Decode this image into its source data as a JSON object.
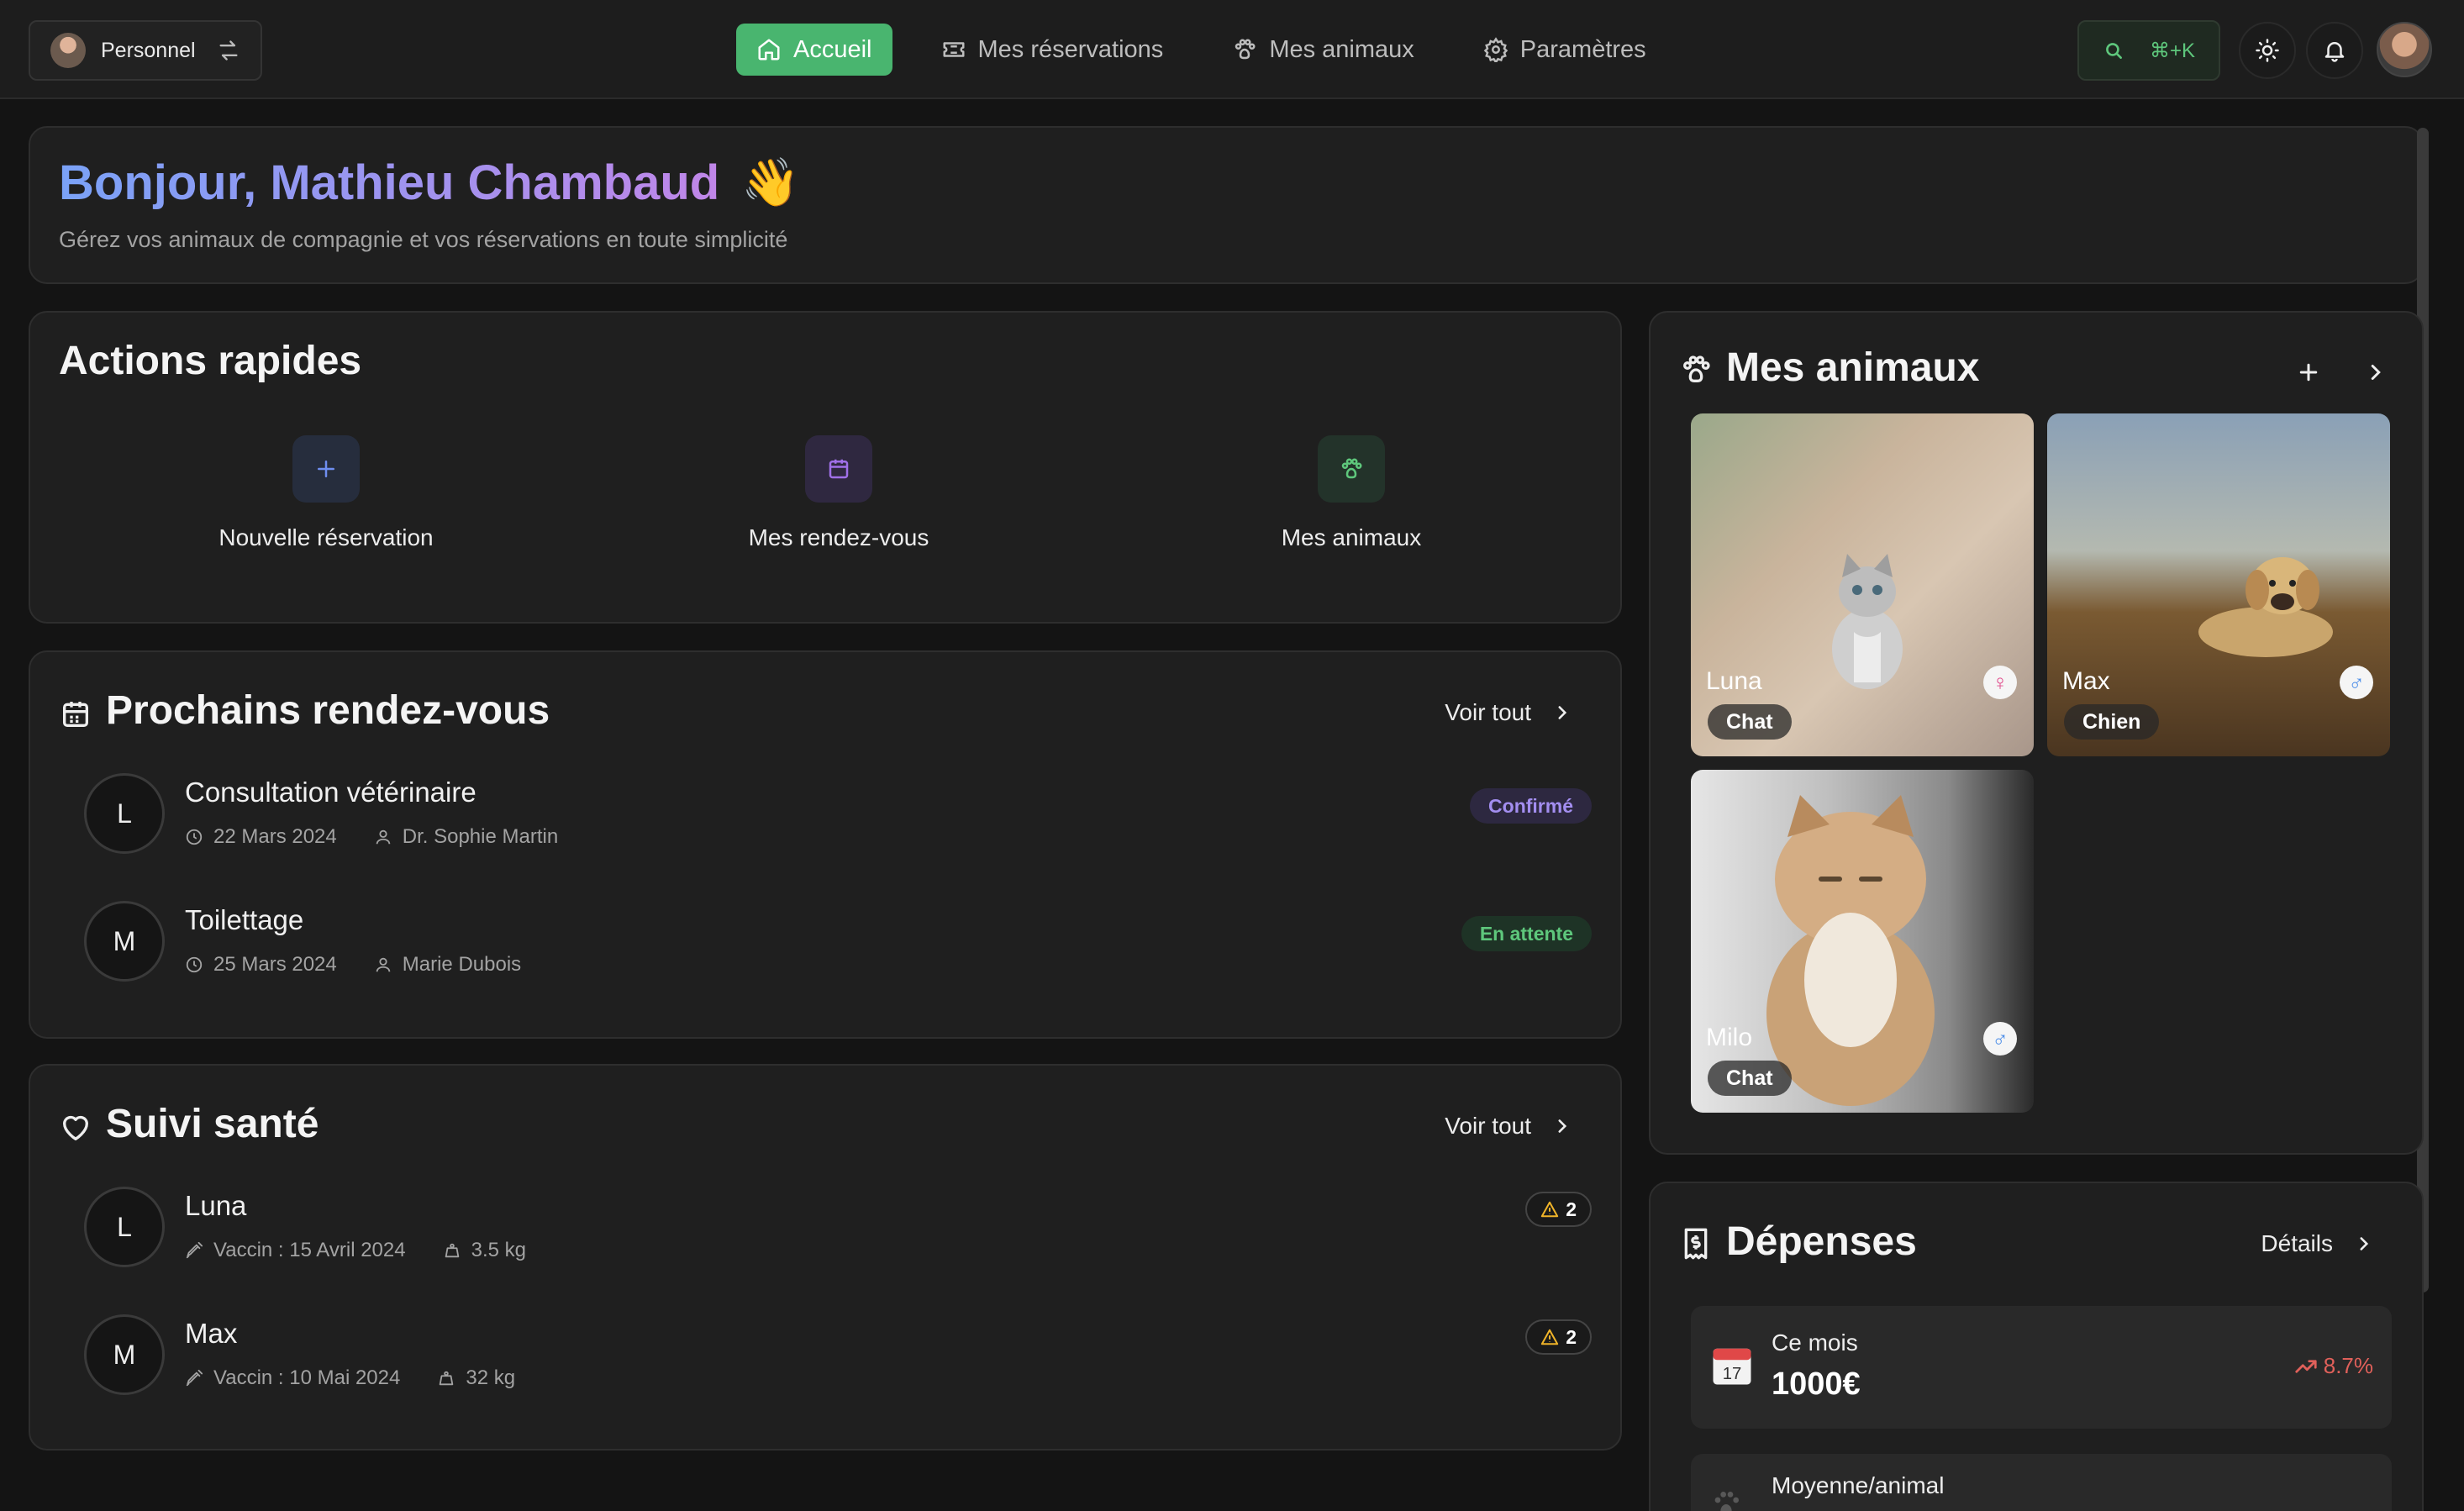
{
  "nav": {
    "account_label": "Personnel",
    "items": [
      {
        "label": "Accueil",
        "icon": "home-icon",
        "active": true
      },
      {
        "label": "Mes réservations",
        "icon": "ticket-icon",
        "active": false
      },
      {
        "label": "Mes animaux",
        "icon": "paw-icon",
        "active": false
      },
      {
        "label": "Paramètres",
        "icon": "gear-icon",
        "active": false
      }
    ],
    "search_shortcut": "⌘+K",
    "accent_color": "#49b56f"
  },
  "greeting": {
    "title": "Bonjour, Mathieu Chambaud",
    "emoji": "👋",
    "subtitle": "Gérez vos animaux de compagnie et vos réservations en toute simplicité"
  },
  "quick_actions": {
    "title": "Actions rapides",
    "items": [
      {
        "label": "Nouvelle réservation",
        "icon": "plus-icon"
      },
      {
        "label": "Mes rendez-vous",
        "icon": "calendar-icon"
      },
      {
        "label": "Mes animaux",
        "icon": "paw-icon"
      }
    ]
  },
  "appointments": {
    "title": "Prochains rendez-vous",
    "see_all": "Voir tout",
    "items": [
      {
        "initial": "L",
        "title": "Consultation vétérinaire",
        "date": "22 Mars 2024",
        "person": "Dr. Sophie Martin",
        "status": "Confirmé"
      },
      {
        "initial": "M",
        "title": "Toilettage",
        "date": "25 Mars 2024",
        "person": "Marie Dubois",
        "status": "En attente"
      }
    ]
  },
  "health": {
    "title": "Suivi santé",
    "see_all": "Voir tout",
    "items": [
      {
        "initial": "L",
        "name": "Luna",
        "vaccine": "Vaccin : 15 Avril 2024",
        "weight": "3.5 kg",
        "alerts": "2"
      },
      {
        "initial": "M",
        "name": "Max",
        "vaccine": "Vaccin : 10 Mai 2024",
        "weight": "32 kg",
        "alerts": "2"
      }
    ]
  },
  "pets": {
    "title": "Mes animaux",
    "items": [
      {
        "name": "Luna",
        "type": "Chat",
        "sex": "♀"
      },
      {
        "name": "Max",
        "type": "Chien",
        "sex": "♂"
      },
      {
        "name": "Milo",
        "type": "Chat",
        "sex": "♂"
      }
    ]
  },
  "expenses": {
    "title": "Dépenses",
    "details": "Détails",
    "month_label": "Ce mois",
    "month_value": "1000€",
    "month_trend": "8.7%",
    "avg_label": "Moyenne/animal"
  }
}
